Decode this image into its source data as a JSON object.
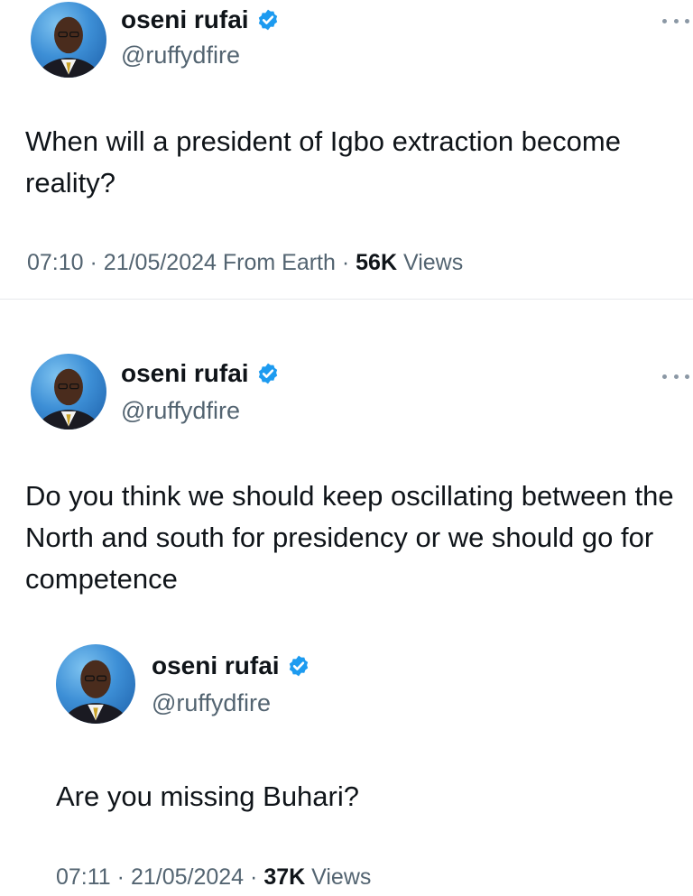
{
  "tweet1": {
    "author": {
      "name": "oseni rufai",
      "handle": "@ruffydfire"
    },
    "text": "When will a president of Igbo extraction become reality?",
    "meta": {
      "time": "07:10",
      "sep1": "·",
      "date": "21/05/2024",
      "source": "From Earth",
      "sep2": "·",
      "views_count": "56K",
      "views_label": "Views"
    }
  },
  "tweet2": {
    "author": {
      "name": "oseni rufai",
      "handle": "@ruffydfire"
    },
    "text": "Do you think we should keep oscillating between the North and south for presidency or we should go for competence",
    "quoted": {
      "author": {
        "name": "oseni rufai",
        "handle": "@ruffydfire"
      },
      "text": "Are you missing Buhari?"
    },
    "meta": {
      "time": "07:11",
      "sep1": "·",
      "date": "21/05/2024",
      "sep2": "·",
      "views_count": "37K",
      "views_label": "Views"
    }
  },
  "colors": {
    "accent": "#1d9bf0",
    "secondary_text": "#536471",
    "primary_text": "#0f1419"
  },
  "icons": {
    "verified": "verified-badge-icon",
    "more": "more-options-icon"
  }
}
